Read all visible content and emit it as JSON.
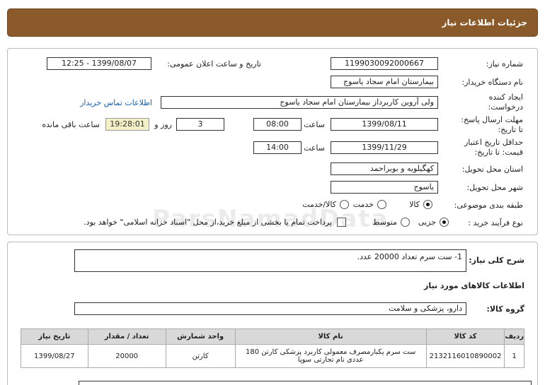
{
  "header": {
    "title": "جزئیات اطلاعات نیاز"
  },
  "fields": {
    "need_number_label": "شماره نیاز:",
    "need_number": "1199030092000667",
    "announce_label": "تاریخ و ساعت اعلان عمومی:",
    "announce_value": "1399/08/07 - 12:25",
    "buyer_org_label": "نام دستگاه خریدار:",
    "buyer_org": "بیمارستان امام سجاد یاسوج",
    "requester_label_1": "ایجاد کننده",
    "requester_label_2": "درخواست:",
    "requester": "ولی آروین کاربرداز بیمارستان امام سجاد یاسوج",
    "contact_link": "اطلاعات تماس خریدار",
    "reply_deadline_label_1": "مهلت ارسال پاسخ:",
    "reply_deadline_label_2": "تا تاریخ:",
    "reply_date": "1399/08/11",
    "time_label": "ساعت",
    "reply_time": "08:00",
    "days": "3",
    "days_label": "روز و",
    "remaining_time": "19:28:01",
    "remaining_label": "ساعت باقی مانده",
    "validity_label_1": "حداقل تاریخ اعتبار",
    "validity_label_2": "قیمت: تا تاریخ:",
    "validity_date": "1399/11/29",
    "validity_time": "14:00",
    "province_label": "استان محل تحویل:",
    "province": "کهگیلویه و بویراحمد",
    "city_label": "شهر محل تحویل:",
    "city": "یاسوج",
    "category_label": "طبقه بندی موضوعی:",
    "category_options": [
      "کالا",
      "خدمت",
      "کالا/خدمت"
    ],
    "process_label": "نوع فرآیند خرید :",
    "process_options": [
      "جزیی",
      "متوسط"
    ],
    "payment_note": "پرداخت تمام یا بخشی از مبلغ خرید،از محل \"اسناد خزانه اسلامی\" خواهد بود."
  },
  "summary": {
    "label": "شرح کلی نیاز:",
    "text": "1- ست سرم تعداد 20000 عدد."
  },
  "goods": {
    "section_title": "اطلاعات کالاهای مورد نیاز",
    "group_label": "گروه کالا:",
    "group_value": "دارو، پزشکی و سلامت",
    "columns": [
      "ردیف",
      "کد کالا",
      "نام کالا",
      "واحد شمارش",
      "تعداد / مقدار",
      "تاریخ نیاز"
    ],
    "rows": [
      [
        "1",
        "2132116010890002",
        "ست سرم یکبارمصرف معمولی کاربرد پزشکی کارتن 180 عددی نام تجارتی سوپا",
        "کارتن",
        "20000",
        "1399/08/27"
      ]
    ]
  },
  "watermark": "ParsNamadData"
}
